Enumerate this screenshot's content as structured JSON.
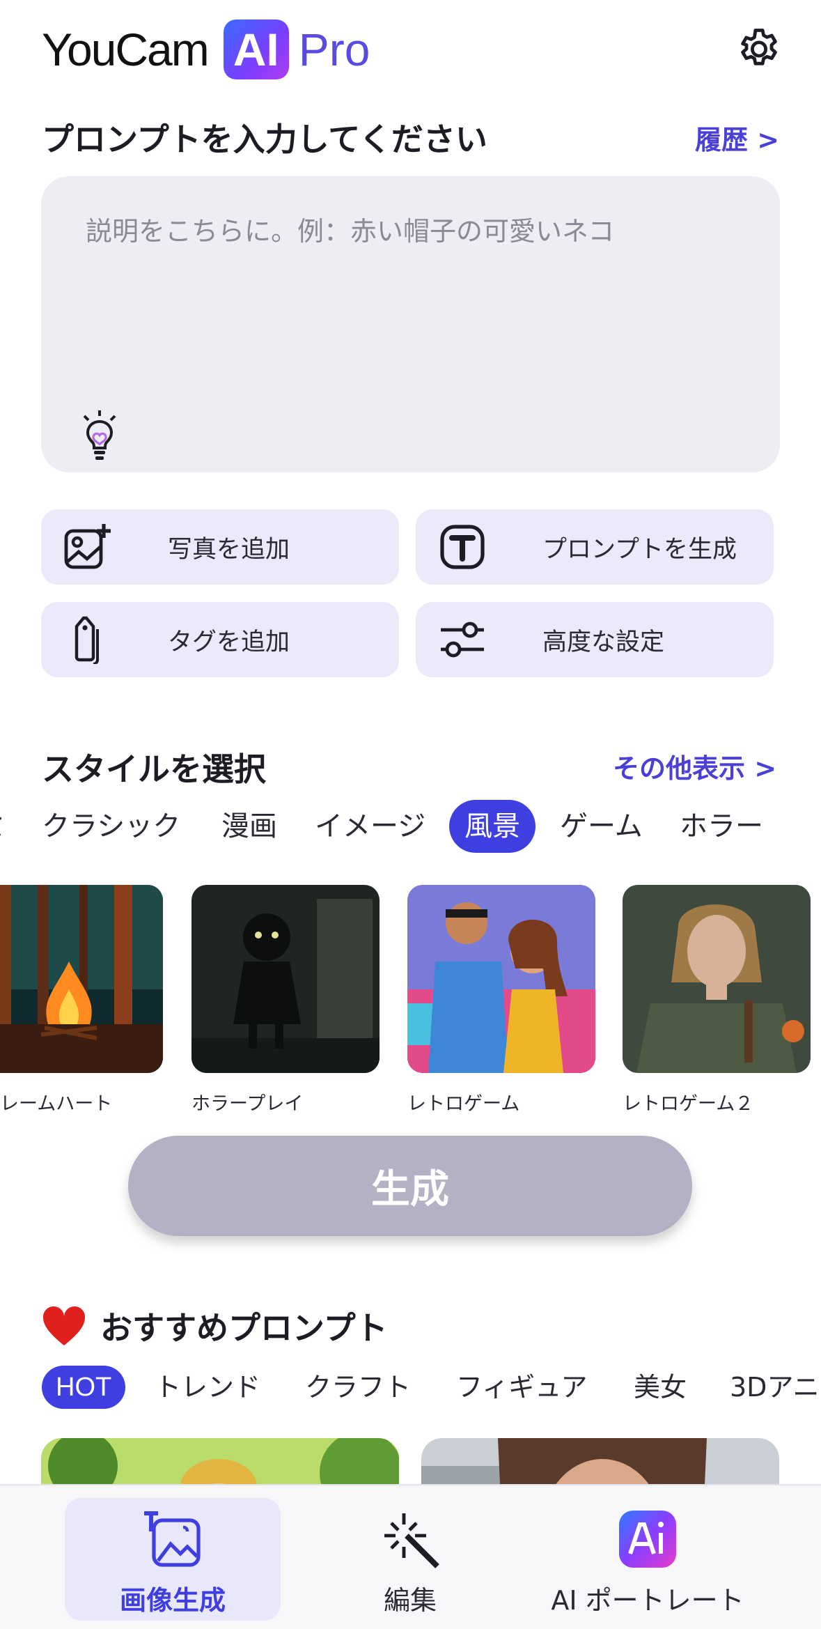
{
  "header": {
    "logo_you": "YouCam",
    "logo_ai": "AI",
    "logo_pro": "Pro"
  },
  "prompt": {
    "title": "プロンプトを入力してください",
    "history_link": "履歴 >",
    "placeholder": "説明をこちらに。例：赤い帽子の可愛いネコ"
  },
  "actions": [
    {
      "label": "写真を追加",
      "icon": "add-photo-icon"
    },
    {
      "label": "プロンプトを生成",
      "icon": "text-t-icon"
    },
    {
      "label": "タグを追加",
      "icon": "tag-icon"
    },
    {
      "label": "高度な設定",
      "icon": "sliders-icon"
    }
  ],
  "styles": {
    "title": "スタイルを選択",
    "more_link": "その他表示 >",
    "categories": [
      "ミ",
      "クラシック",
      "漫画",
      "イメージ",
      "風景",
      "ゲーム",
      "ホラー"
    ],
    "active_category": "風景",
    "items": [
      "レームハート",
      "ホラープレイ",
      "レトロゲーム",
      "レトロゲーム２"
    ]
  },
  "generate_button": "生成",
  "recommended": {
    "title": "おすすめプロンプト",
    "categories": [
      "HOT",
      "トレンド",
      "クラフト",
      "フィギュア",
      "美女",
      "3Dアニ"
    ],
    "active_category": "HOT"
  },
  "tabbar": {
    "tabs": [
      {
        "label": "画像生成",
        "icon": "image-generate-icon",
        "active": true
      },
      {
        "label": "編集",
        "icon": "magic-wand-icon",
        "active": false
      },
      {
        "label": "AI ポートレート",
        "icon": "ai-portrait-icon",
        "active": false
      }
    ]
  },
  "colors": {
    "accent": "#3f3ee0",
    "link": "#4a3fd6",
    "button_bg": "#ebeafb",
    "generate_disabled": "#b3b2c4"
  }
}
